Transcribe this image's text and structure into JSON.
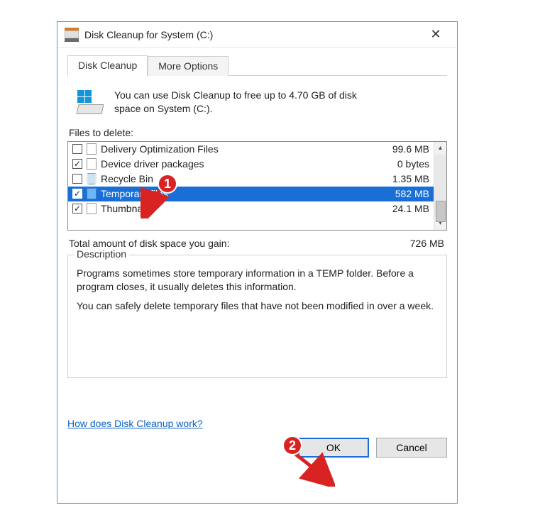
{
  "window": {
    "title": "Disk Cleanup for System (C:)"
  },
  "tabs": {
    "cleanup": "Disk Cleanup",
    "more": "More Options"
  },
  "intro": "You can use Disk Cleanup to free up to 4.70 GB of disk space on System (C:).",
  "files_label": "Files to delete:",
  "items": [
    {
      "name": "Delivery Optimization Files",
      "size": "99.6 MB",
      "checked": false,
      "icon": "plain",
      "selected": false
    },
    {
      "name": "Device driver packages",
      "size": "0 bytes",
      "checked": true,
      "icon": "plain",
      "selected": false
    },
    {
      "name": "Recycle Bin",
      "size": "1.35 MB",
      "checked": false,
      "icon": "bin",
      "selected": false
    },
    {
      "name": "Temporary files",
      "size": "582 MB",
      "checked": true,
      "icon": "blue",
      "selected": true
    },
    {
      "name": "Thumbnails",
      "size": "24.1 MB",
      "checked": true,
      "icon": "plain",
      "selected": false
    }
  ],
  "total": {
    "label": "Total amount of disk space you gain:",
    "value": "726 MB"
  },
  "description": {
    "legend": "Description",
    "p1": "Programs sometimes store temporary information in a TEMP folder. Before a program closes, it usually deletes this information.",
    "p2": "You can safely delete temporary files that have not been modified in over a week."
  },
  "link": "How does Disk Cleanup work?",
  "buttons": {
    "ok": "OK",
    "cancel": "Cancel"
  },
  "callouts": {
    "one": "1",
    "two": "2"
  }
}
